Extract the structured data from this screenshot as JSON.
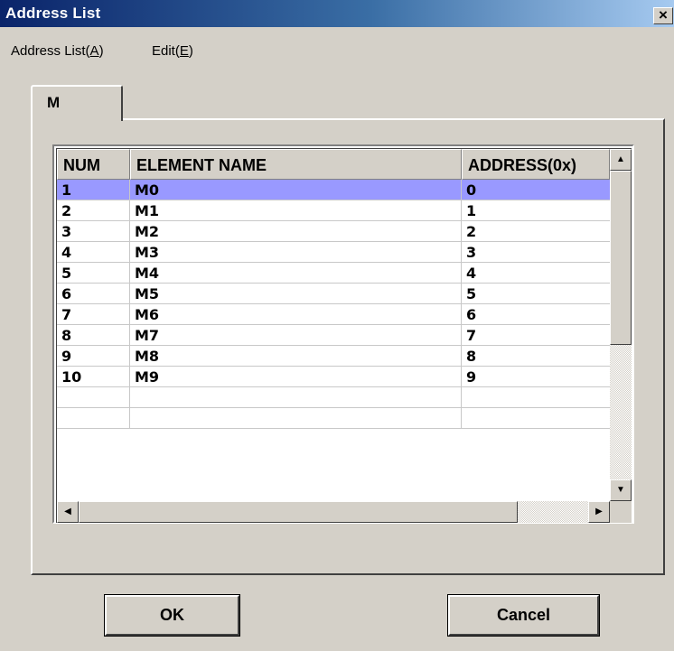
{
  "window": {
    "title": "Address List",
    "close_label": "×"
  },
  "menu": {
    "items": [
      {
        "pre": "Address List(",
        "key": "A",
        "post": ")"
      },
      {
        "pre": "Edit(",
        "key": "E",
        "post": ")"
      }
    ]
  },
  "tabs": [
    {
      "label": "M",
      "active": true
    }
  ],
  "grid": {
    "headers": [
      "NUM",
      "ELEMENT NAME",
      "ADDRESS(0x)"
    ],
    "rows": [
      [
        "1",
        "M0",
        "0"
      ],
      [
        "2",
        "M1",
        "1"
      ],
      [
        "3",
        "M2",
        "2"
      ],
      [
        "4",
        "M3",
        "3"
      ],
      [
        "5",
        "M4",
        "4"
      ],
      [
        "6",
        "M5",
        "5"
      ],
      [
        "7",
        "M6",
        "6"
      ],
      [
        "8",
        "M7",
        "7"
      ],
      [
        "9",
        "M8",
        "8"
      ],
      [
        "10",
        "M9",
        "9"
      ],
      [
        "",
        "",
        ""
      ],
      [
        "",
        "",
        ""
      ]
    ],
    "selected_row": 0,
    "selection_color": "#9999ff"
  },
  "buttons": {
    "ok": "OK",
    "cancel": "Cancel"
  },
  "icons": {
    "up": "▲",
    "down": "▼",
    "left": "◀",
    "right": "▶"
  },
  "colors": {
    "face": "#d4d0c8",
    "title_start": "#0a246a",
    "title_end": "#a6caf0"
  }
}
